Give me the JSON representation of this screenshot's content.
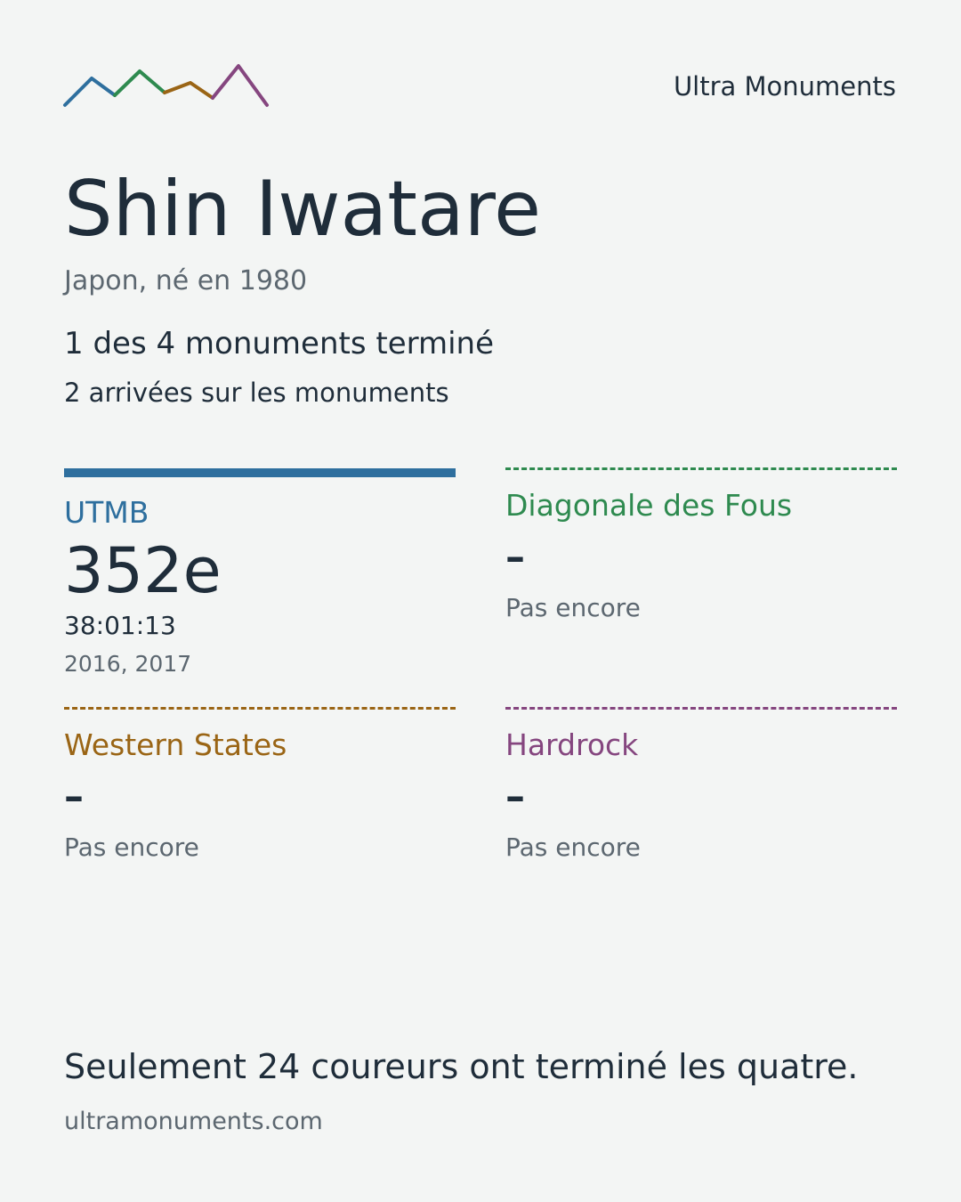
{
  "colors": {
    "utmb": "#2e6f9e",
    "diagonale": "#2e8a4f",
    "western": "#9a6515",
    "hardrock": "#85467f",
    "text": "#1f2d3a",
    "muted": "#5c6770",
    "background": "#f3f5f4"
  },
  "logo": {
    "icon": "mountain-range-logo-icon"
  },
  "brand": "Ultra Monuments",
  "runner": {
    "name": "Shin Iwatare",
    "subtitle": "Japon, né en 1980",
    "summary": "1 des 4 monuments terminé",
    "finishes": "2 arrivées sur les monuments"
  },
  "races": [
    {
      "title": "UTMB",
      "rank": "352e",
      "time": "38:01:13",
      "years": "2016, 2017",
      "completed": true
    },
    {
      "title": "Diagonale des Fous",
      "rank": "–",
      "status": "Pas encore",
      "completed": false
    },
    {
      "title": "Western States",
      "rank": "–",
      "status": "Pas encore",
      "completed": false
    },
    {
      "title": "Hardrock",
      "rank": "–",
      "status": "Pas encore",
      "completed": false
    }
  ],
  "footer": {
    "statement": "Seulement 24 coureurs ont terminé les quatre.",
    "website": "ultramonuments.com"
  }
}
